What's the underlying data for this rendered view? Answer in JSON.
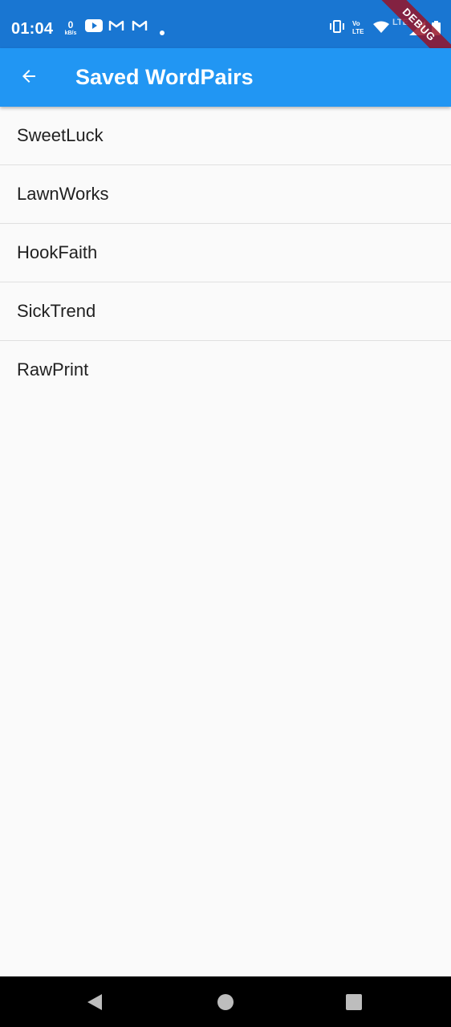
{
  "status_bar": {
    "time": "01:04",
    "speed_value": "0",
    "speed_unit": "kB/s",
    "network_label": "LTE",
    "icons": [
      "youtube-icon",
      "gmail-icon",
      "gmail-icon",
      "dot-icon",
      "vibrate-icon",
      "volte-icon",
      "wifi-icon",
      "signal-icon",
      "battery-icon"
    ],
    "debug_banner": "DEBUG"
  },
  "app_bar": {
    "title": "Saved WordPairs",
    "back_icon": "arrow-back-icon",
    "background_color": "#2196f3"
  },
  "saved_pairs": [
    "SweetLuck",
    "LawnWorks",
    "HookFaith",
    "SickTrend",
    "RawPrint"
  ],
  "navigation_bar": {
    "buttons": [
      "back-triangle-icon",
      "home-circle-icon",
      "recents-square-icon"
    ]
  }
}
